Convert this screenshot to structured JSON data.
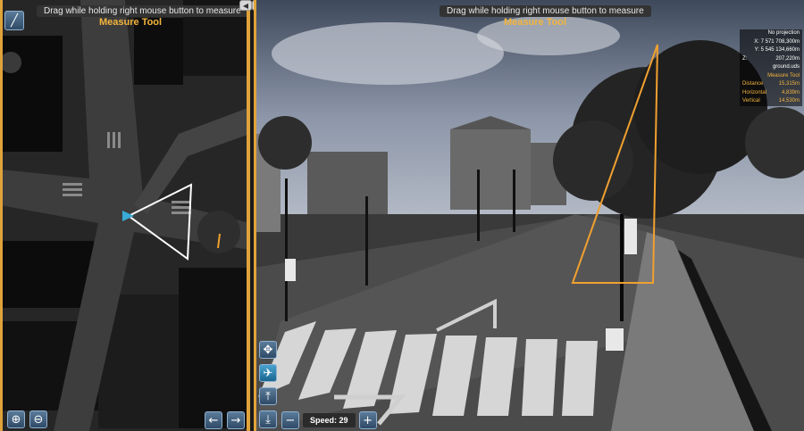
{
  "left_view": {
    "hint": "Drag while holding right mouse button to measure",
    "tool_label": "Measure Tool"
  },
  "right_view": {
    "hint": "Drag while holding right mouse button to measure",
    "tool_label": "Measure Tool"
  },
  "info_panel": {
    "projection": "No projection",
    "x": "X: 7 571 708,300m",
    "y": "Y: 5 545 134,660m",
    "z_label": "Z:",
    "z_value": "207,220m",
    "layer": "ground.uds",
    "measure_title": "Measure Tool",
    "distance_label": "Distance",
    "distance_value": "15,315m",
    "horizontal_label": "Horizontal",
    "horizontal_value": "4,839m",
    "vertical_label": "Vertical",
    "vertical_value": "14,530m"
  },
  "speed": {
    "label": "Speed: 29"
  },
  "icons": {
    "measure": "measure-tool-icon",
    "zoom_in": "zoom-in-icon",
    "zoom_out": "zoom-out-icon",
    "arrow_left": "arrow-left-icon",
    "arrow_right": "arrow-right-icon",
    "collapse_left": "collapse-left-icon",
    "collapse_right": "collapse-right-icon"
  },
  "colors": {
    "frame": "#e0a33a",
    "accent_label": "#f3b43d",
    "measure_line": "#f0a030",
    "button": "#3f6080"
  }
}
